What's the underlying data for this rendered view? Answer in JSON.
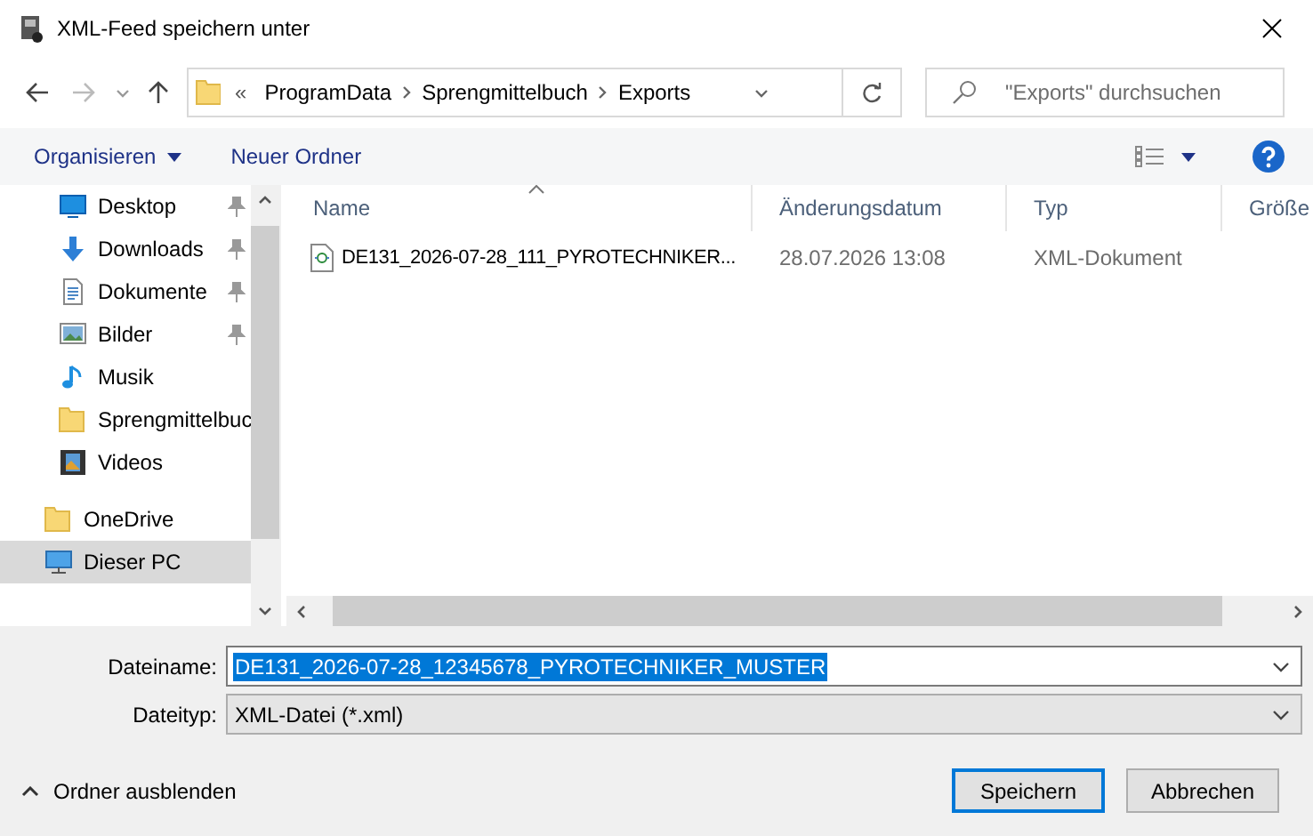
{
  "window": {
    "title": "XML-Feed speichern unter"
  },
  "navigation": {
    "overflow_mark": "«",
    "path": [
      "ProgramData",
      "Sprengmittelbuch",
      "Exports"
    ],
    "search": {
      "placeholder": "\"Exports\" durchsuchen"
    }
  },
  "toolbar": {
    "organize": "Organisieren",
    "new_folder": "Neuer Ordner"
  },
  "sidebar": {
    "quick_access": [
      {
        "label": "Desktop",
        "kind": "desktop",
        "pinned": true,
        "selected": false
      },
      {
        "label": "Downloads",
        "kind": "downloads",
        "pinned": true,
        "selected": false
      },
      {
        "label": "Dokumente",
        "kind": "documents",
        "pinned": true,
        "selected": false
      },
      {
        "label": "Bilder",
        "kind": "pictures",
        "pinned": true,
        "selected": false
      },
      {
        "label": "Musik",
        "kind": "music",
        "pinned": false,
        "selected": false
      },
      {
        "label": "Sprengmittelbuc",
        "kind": "folder",
        "pinned": false,
        "selected": false
      },
      {
        "label": "Videos",
        "kind": "videos",
        "pinned": false,
        "selected": false
      }
    ],
    "items": [
      {
        "label": "OneDrive",
        "kind": "folder",
        "selected": false
      },
      {
        "label": "Dieser PC",
        "kind": "pc",
        "selected": true
      }
    ]
  },
  "file_list": {
    "columns": [
      {
        "label": "Name",
        "sorted": true
      },
      {
        "label": "Änderungsdatum",
        "sorted": false
      },
      {
        "label": "Typ",
        "sorted": false
      },
      {
        "label": "Größe",
        "sorted": false
      }
    ],
    "rows": [
      {
        "name": "DE131_2026-07-28_111_PYROTECHNIKER...",
        "modified": "28.07.2026 13:08",
        "type": "XML-Dokument",
        "selected": false
      }
    ]
  },
  "footer": {
    "filename_label": "Dateiname:",
    "filename": "DE131_2026-07-28_12345678_PYROTECHNIKER_MUSTER",
    "filename_text_selected": true,
    "filetype_label": "Dateityp:",
    "filetype": "XML-Datei (*.xml)",
    "hide_folders": "Ordner ausblenden",
    "save": "Speichern",
    "cancel": "Abbrechen"
  }
}
